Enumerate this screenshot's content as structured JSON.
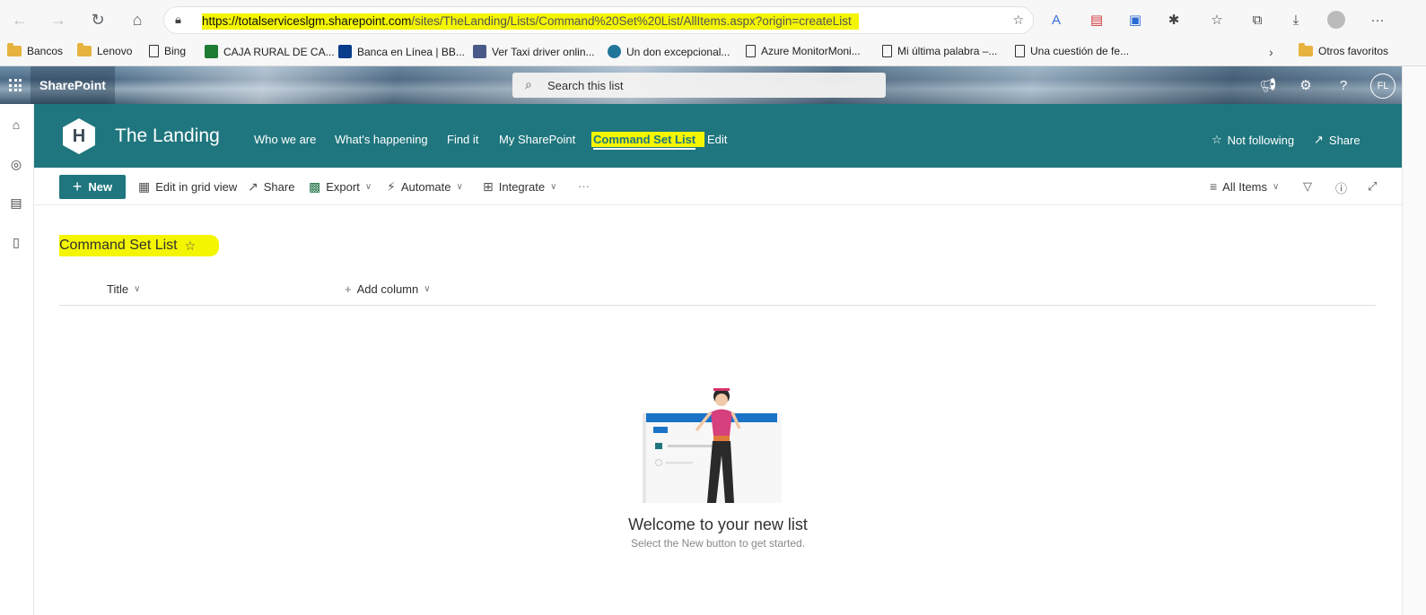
{
  "browser": {
    "url_host": "https://totalserviceslgm.sharepoint.com",
    "url_path": "/sites/TheLanding/Lists/Command%20Set%20List/AllItems.aspx?origin=createList"
  },
  "bookmarks": [
    {
      "label": "Bancos",
      "icon": "folder-icon"
    },
    {
      "label": "Lenovo",
      "icon": "folder-icon"
    },
    {
      "label": "Bing",
      "icon": "page-icon"
    },
    {
      "label": "CAJA RURAL DE CA...",
      "icon": "caja-rural-icon"
    },
    {
      "label": "Banca en Línea | BB...",
      "icon": "bbva-icon"
    },
    {
      "label": "Ver Taxi driver onlin...",
      "icon": "site-icon"
    },
    {
      "label": "Un don excepcional...",
      "icon": "wordpress-icon"
    },
    {
      "label": "Azure MonitorMoni...",
      "icon": "page-icon"
    },
    {
      "label": "Mi última palabra –...",
      "icon": "page-icon"
    },
    {
      "label": "Una cuestión de fe...",
      "icon": "page-icon"
    }
  ],
  "bookmarks_other": "Otros favoritos",
  "suite": {
    "brand": "SharePoint",
    "search_placeholder": "Search this list",
    "avatar_initials": "FL"
  },
  "site": {
    "logo_letter": "H",
    "title": "The Landing",
    "nav": [
      "Who we are",
      "What's happening",
      "Find it",
      "My SharePoint",
      "Command Set List",
      "Edit"
    ],
    "not_following": "Not following",
    "share": "Share"
  },
  "commandbar": {
    "new": "New",
    "edit_grid": "Edit in grid view",
    "share": "Share",
    "export": "Export",
    "automate": "Automate",
    "integrate": "Integrate",
    "more": "···",
    "view": "All Items"
  },
  "list": {
    "title": "Command Set List",
    "columns": [
      "Title",
      "Add column"
    ]
  },
  "empty_state": {
    "title": "Welcome to your new list",
    "subtitle": "Select the New button to get started."
  },
  "colors": {
    "theme": "#1f767e",
    "highlight": "#f4f500"
  }
}
